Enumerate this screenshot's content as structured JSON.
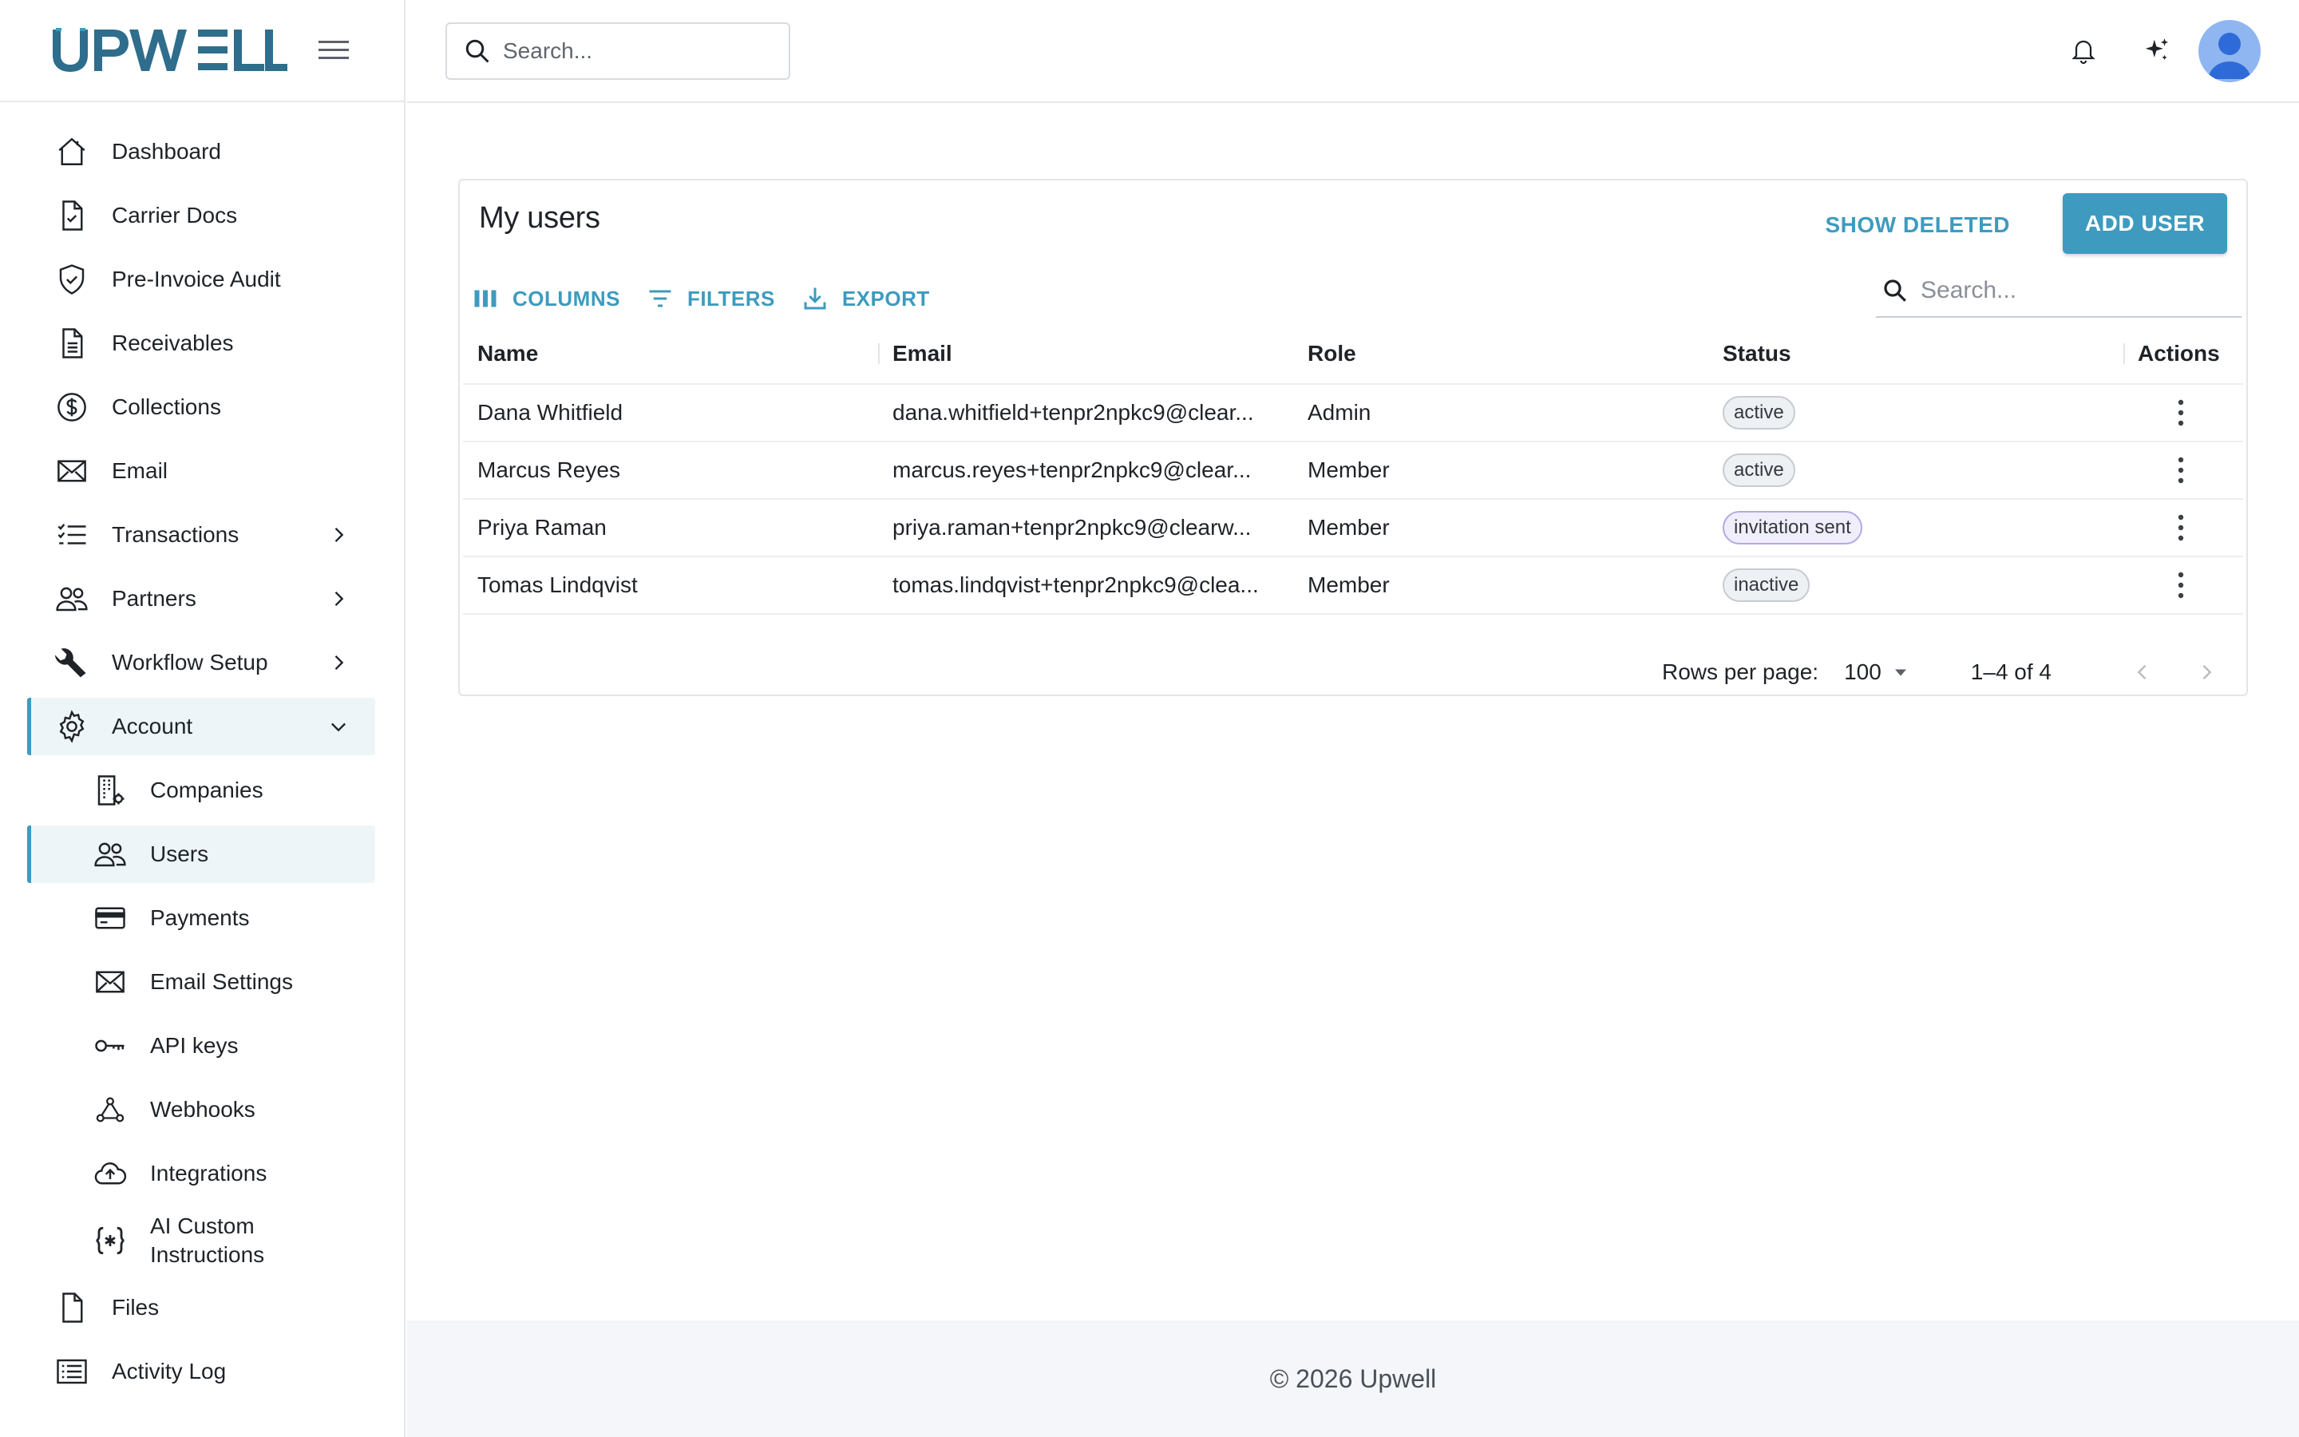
{
  "brand": {
    "logo_text": "UPWELL",
    "accent": "#3e9bbf",
    "logo_color": "#2f6d8c"
  },
  "topbar": {
    "search_placeholder": "Search..."
  },
  "sidebar": {
    "items": [
      {
        "label": "Dashboard",
        "icon": "home-icon"
      },
      {
        "label": "Carrier Docs",
        "icon": "file-check-icon"
      },
      {
        "label": "Pre-Invoice Audit",
        "icon": "shield-check-icon"
      },
      {
        "label": "Receivables",
        "icon": "document-icon"
      },
      {
        "label": "Collections",
        "icon": "dollar-circle-icon"
      },
      {
        "label": "Email",
        "icon": "mail-icon"
      },
      {
        "label": "Transactions",
        "icon": "list-check-icon"
      },
      {
        "label": "Partners",
        "icon": "people-icon"
      },
      {
        "label": "Workflow Setup",
        "icon": "wrench-icon"
      },
      {
        "label": "Account",
        "icon": "gear-icon"
      }
    ],
    "sub_items": [
      {
        "label": "Companies",
        "icon": "building-gear-icon"
      },
      {
        "label": "Users",
        "icon": "users-icon"
      },
      {
        "label": "Payments",
        "icon": "credit-card-icon"
      },
      {
        "label": "Email Settings",
        "icon": "mail-icon"
      },
      {
        "label": "API keys",
        "icon": "key-icon"
      },
      {
        "label": "Webhooks",
        "icon": "webhook-icon"
      },
      {
        "label": "Integrations",
        "icon": "cloud-upload-icon"
      },
      {
        "label_1": "AI Custom",
        "label_2": "Instructions",
        "icon": "braces-asterisk-icon"
      }
    ],
    "bottom_items": [
      {
        "label": "Files",
        "icon": "file-icon"
      },
      {
        "label": "Activity Log",
        "icon": "list-icon"
      }
    ]
  },
  "card": {
    "title": "My users",
    "show_deleted": "SHOW DELETED",
    "add_user": "ADD USER",
    "toolbar": {
      "columns": "COLUMNS",
      "filters": "FILTERS",
      "export": "EXPORT"
    },
    "search_placeholder": "Search...",
    "columns": [
      "Name",
      "Email",
      "Role",
      "Status",
      "Actions"
    ],
    "rows": [
      {
        "name": "Dana Whitfield",
        "email": "dana.whitfield+tenpr2npkc9@clear...",
        "role": "Admin",
        "status": "active"
      },
      {
        "name": "Marcus Reyes",
        "email": "marcus.reyes+tenpr2npkc9@clear...",
        "role": "Member",
        "status": "active"
      },
      {
        "name": "Priya Raman",
        "email": "priya.raman+tenpr2npkc9@clearw...",
        "role": "Member",
        "status": "invitation sent"
      },
      {
        "name": "Tomas Lindqvist",
        "email": "tomas.lindqvist+tenpr2npkc9@clea...",
        "role": "Member",
        "status": "inactive"
      }
    ],
    "pager": {
      "rows_per_page_label": "Rows per page:",
      "rows_per_page": "100",
      "range": "1–4 of 4"
    }
  },
  "footer": {
    "text": "© 2026 Upwell"
  }
}
